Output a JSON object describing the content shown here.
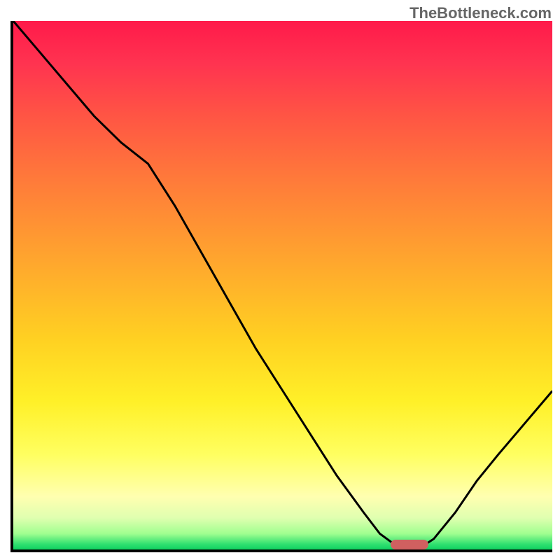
{
  "watermark": "TheBottleneck.com",
  "chart_data": {
    "type": "line",
    "title": "",
    "xlabel": "",
    "ylabel": "",
    "x": [
      0,
      5,
      10,
      15,
      20,
      25,
      30,
      35,
      40,
      45,
      50,
      55,
      60,
      65,
      68,
      72,
      75,
      78,
      82,
      86,
      90,
      95,
      100
    ],
    "y": [
      100,
      94,
      88,
      82,
      77,
      73,
      65,
      56,
      47,
      38,
      30,
      22,
      14,
      7,
      3,
      0,
      0,
      2,
      7,
      13,
      18,
      24,
      30
    ],
    "xlim": [
      0,
      100
    ],
    "ylim": [
      0,
      100
    ],
    "marker": {
      "x_start": 70,
      "x_end": 77,
      "y": 0
    },
    "gradient_stops": [
      {
        "pos": 0,
        "color": "#ff1a4a"
      },
      {
        "pos": 50,
        "color": "#ffb028"
      },
      {
        "pos": 82,
        "color": "#ffff60"
      },
      {
        "pos": 100,
        "color": "#10d060"
      }
    ]
  }
}
